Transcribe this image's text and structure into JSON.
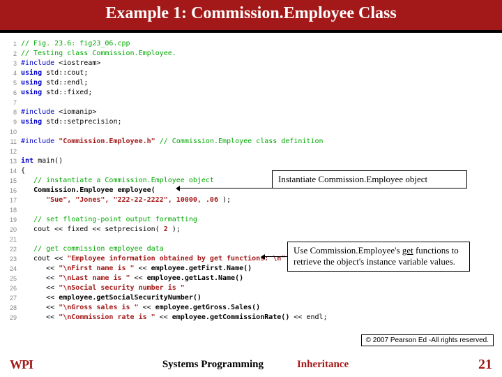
{
  "header": {
    "title": "Example 1: Commission.Employee Class"
  },
  "callouts": {
    "c1": "Instantiate Commission.Employee object",
    "c2a": "Use Commission.Employee's ",
    "c2_get": "get",
    "c2b": " functions to retrieve the object's instance variable values."
  },
  "copyright": "© 2007 Pearson Ed -All rights reserved.",
  "footer": {
    "logo": "WPI",
    "leftText": "Systems Programming",
    "rightText": "Inheritance",
    "page": "21"
  },
  "code": [
    {
      "n": "1",
      "parts": [
        {
          "c": "cm",
          "t": "// Fig. 23.6: fig23_06.cpp"
        }
      ]
    },
    {
      "n": "2",
      "parts": [
        {
          "c": "cm",
          "t": "// Testing class Commission.Employee."
        }
      ]
    },
    {
      "n": "3",
      "parts": [
        {
          "c": "pp",
          "t": "#include "
        },
        {
          "c": "sysinc",
          "t": "<iostream>"
        }
      ]
    },
    {
      "n": "4",
      "parts": [
        {
          "c": "kw",
          "t": "using"
        },
        {
          "c": "",
          "t": " std::cout;"
        }
      ]
    },
    {
      "n": "5",
      "parts": [
        {
          "c": "kw",
          "t": "using"
        },
        {
          "c": "",
          "t": " std::endl;"
        }
      ]
    },
    {
      "n": "6",
      "parts": [
        {
          "c": "kw",
          "t": "using"
        },
        {
          "c": "",
          "t": " std::fixed;"
        }
      ]
    },
    {
      "n": "7",
      "parts": []
    },
    {
      "n": "8",
      "parts": [
        {
          "c": "pp",
          "t": "#include "
        },
        {
          "c": "sysinc",
          "t": "<iomanip>"
        }
      ]
    },
    {
      "n": "9",
      "parts": [
        {
          "c": "kw",
          "t": "using"
        },
        {
          "c": "",
          "t": " std::setprecision;"
        }
      ]
    },
    {
      "n": "10",
      "parts": []
    },
    {
      "n": "11",
      "parts": [
        {
          "c": "pp",
          "t": "#include "
        },
        {
          "c": "userinc",
          "t": "\"Commission.Employee.h\""
        },
        {
          "c": "",
          "t": " "
        },
        {
          "c": "cm",
          "t": "// Commission.Employee class definition"
        }
      ]
    },
    {
      "n": "12",
      "parts": []
    },
    {
      "n": "13",
      "parts": [
        {
          "c": "kw",
          "t": "int"
        },
        {
          "c": "",
          "t": " main()"
        }
      ]
    },
    {
      "n": "14",
      "parts": [
        {
          "c": "",
          "t": "{"
        }
      ]
    },
    {
      "n": "15",
      "parts": [
        {
          "c": "",
          "t": "   "
        },
        {
          "c": "cm",
          "t": "// instantiate a Commission.Employee object"
        }
      ]
    },
    {
      "n": "16",
      "parts": [
        {
          "c": "",
          "t": "   "
        },
        {
          "c": "fn",
          "t": "Commission.Employee employee("
        }
      ]
    },
    {
      "n": "17",
      "parts": [
        {
          "c": "",
          "t": "      "
        },
        {
          "c": "str",
          "t": "\"Sue\", \"Jones\", \"222-22-2222\", 10000, .06"
        },
        {
          "c": "",
          "t": " );"
        }
      ]
    },
    {
      "n": "18",
      "parts": []
    },
    {
      "n": "19",
      "parts": [
        {
          "c": "",
          "t": "   "
        },
        {
          "c": "cm",
          "t": "// set floating-point output formatting"
        }
      ]
    },
    {
      "n": "20",
      "parts": [
        {
          "c": "",
          "t": "   cout << fixed << setprecision( "
        },
        {
          "c": "str",
          "t": "2"
        },
        {
          "c": "",
          "t": " );"
        }
      ]
    },
    {
      "n": "21",
      "parts": []
    },
    {
      "n": "22",
      "parts": [
        {
          "c": "",
          "t": "   "
        },
        {
          "c": "cm",
          "t": "// get commission employee data"
        }
      ]
    },
    {
      "n": "23",
      "parts": [
        {
          "c": "",
          "t": "   cout << "
        },
        {
          "c": "str",
          "t": "\"Employee information obtained by get functions: \\n\""
        }
      ]
    },
    {
      "n": "24",
      "parts": [
        {
          "c": "",
          "t": "      << "
        },
        {
          "c": "str",
          "t": "\"\\nFirst name is \""
        },
        {
          "c": "",
          "t": " << "
        },
        {
          "c": "fn",
          "t": "employee.getFirst.Name()"
        }
      ]
    },
    {
      "n": "25",
      "parts": [
        {
          "c": "",
          "t": "      << "
        },
        {
          "c": "str",
          "t": "\"\\nLast name is \""
        },
        {
          "c": "",
          "t": " << "
        },
        {
          "c": "fn",
          "t": "employee.getLast.Name()"
        }
      ]
    },
    {
      "n": "26",
      "parts": [
        {
          "c": "",
          "t": "      << "
        },
        {
          "c": "str",
          "t": "\"\\nSocial security number is \""
        }
      ]
    },
    {
      "n": "27",
      "parts": [
        {
          "c": "",
          "t": "      << "
        },
        {
          "c": "fn",
          "t": "employee.getSocialSecurityNumber()"
        }
      ]
    },
    {
      "n": "28",
      "parts": [
        {
          "c": "",
          "t": "      << "
        },
        {
          "c": "str",
          "t": "\"\\nGross sales is \""
        },
        {
          "c": "",
          "t": " << "
        },
        {
          "c": "fn",
          "t": "employee.getGross.Sales()"
        }
      ]
    },
    {
      "n": "29",
      "parts": [
        {
          "c": "",
          "t": "      << "
        },
        {
          "c": "str",
          "t": "\"\\nCommission rate is \""
        },
        {
          "c": "",
          "t": " << "
        },
        {
          "c": "fn",
          "t": "employee.getCommissionRate()"
        },
        {
          "c": "",
          "t": " << endl;"
        }
      ]
    }
  ]
}
